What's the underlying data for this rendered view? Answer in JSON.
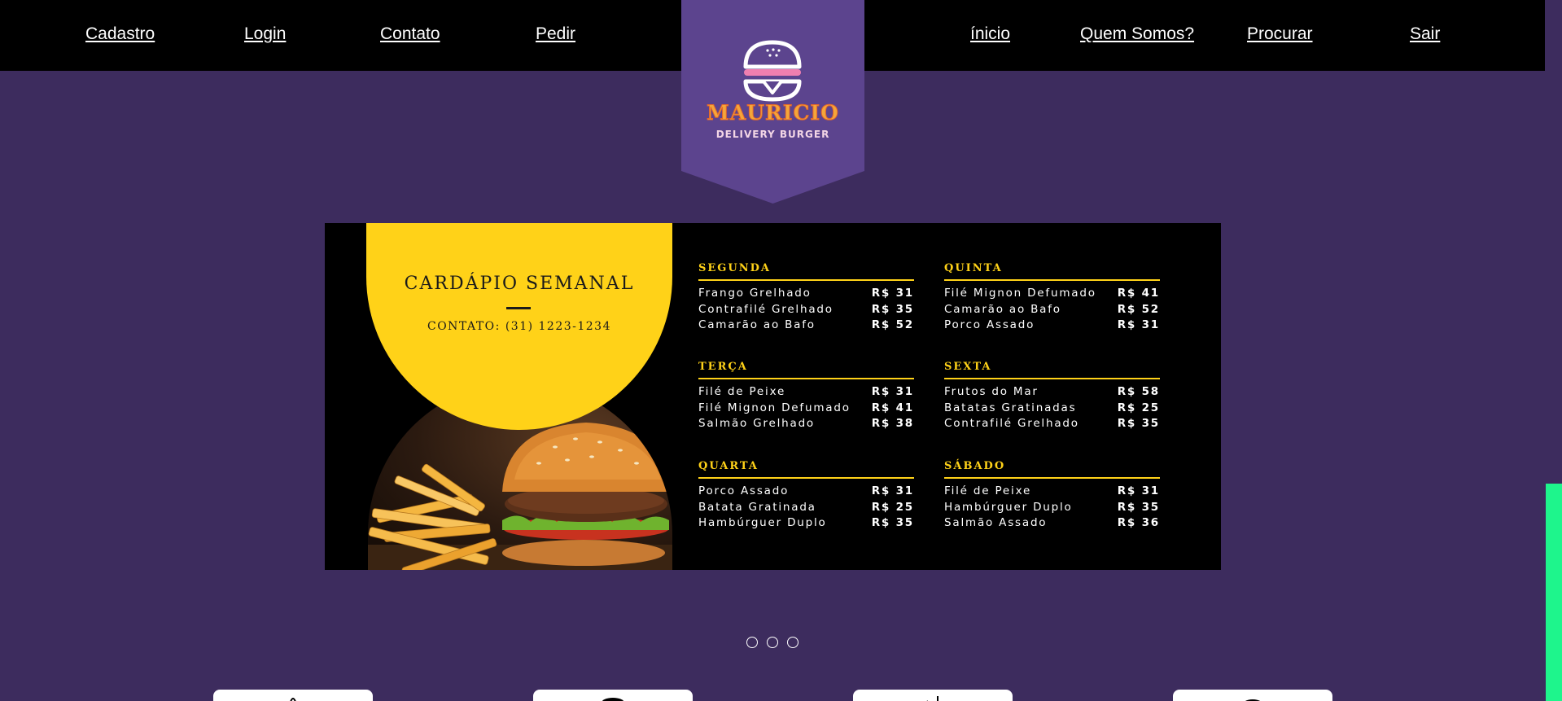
{
  "nav": {
    "left": [
      "Cadastro",
      "Login",
      "Contato",
      "Pedir"
    ],
    "right": [
      "ínicio",
      "Quem Somos?",
      "Procurar",
      "Sair"
    ]
  },
  "logo": {
    "title": "MAURICIO",
    "subtitle": "DELIVERY BURGER",
    "icon": "burger-icon",
    "color": "#5c448e"
  },
  "menu": {
    "title": "CARDÁPIO SEMANAL",
    "contact": "CONTATO: (31) 1223-1234",
    "days": [
      {
        "name": "SEGUNDA",
        "dishes": [
          {
            "dish": "Frango Grelhado",
            "price": "R$ 31"
          },
          {
            "dish": "Contrafilé Grelhado",
            "price": "R$ 35"
          },
          {
            "dish": "Camarão ao Bafo",
            "price": "R$ 52"
          }
        ]
      },
      {
        "name": "TERÇA",
        "dishes": [
          {
            "dish": "Filé de Peixe",
            "price": "R$ 31"
          },
          {
            "dish": "Filé Mignon Defumado",
            "price": "R$ 41"
          },
          {
            "dish": "Salmão Grelhado",
            "price": "R$ 38"
          }
        ]
      },
      {
        "name": "QUARTA",
        "dishes": [
          {
            "dish": "Porco Assado",
            "price": "R$ 31"
          },
          {
            "dish": "Batata Gratinada",
            "price": "R$ 25"
          },
          {
            "dish": "Hambúrguer Duplo",
            "price": "R$ 35"
          }
        ]
      },
      {
        "name": "QUINTA",
        "dishes": [
          {
            "dish": "Filé Mignon Defumado",
            "price": "R$ 41"
          },
          {
            "dish": "Camarão ao Bafo",
            "price": "R$ 52"
          },
          {
            "dish": "Porco Assado",
            "price": "R$ 31"
          }
        ]
      },
      {
        "name": "SEXTA",
        "dishes": [
          {
            "dish": "Frutos do Mar",
            "price": "R$ 58"
          },
          {
            "dish": "Batatas Gratinadas",
            "price": "R$ 25"
          },
          {
            "dish": "Contrafilé Grelhado",
            "price": "R$ 35"
          }
        ]
      },
      {
        "name": "SÁBADO",
        "dishes": [
          {
            "dish": "Filé de Peixe",
            "price": "R$ 31"
          },
          {
            "dish": "Hambúrguer Duplo",
            "price": "R$ 35"
          },
          {
            "dish": "Salmão Assado",
            "price": "R$ 36"
          }
        ]
      }
    ]
  },
  "carousel": {
    "slides": 3,
    "active": 0
  },
  "cards": [
    "card-1",
    "card-2",
    "card-3",
    "card-4"
  ],
  "colors": {
    "background": "#3d2c5e",
    "navbar": "#000000",
    "accent_yellow": "#ffd218",
    "scroll_thumb": "#1ef58c"
  }
}
